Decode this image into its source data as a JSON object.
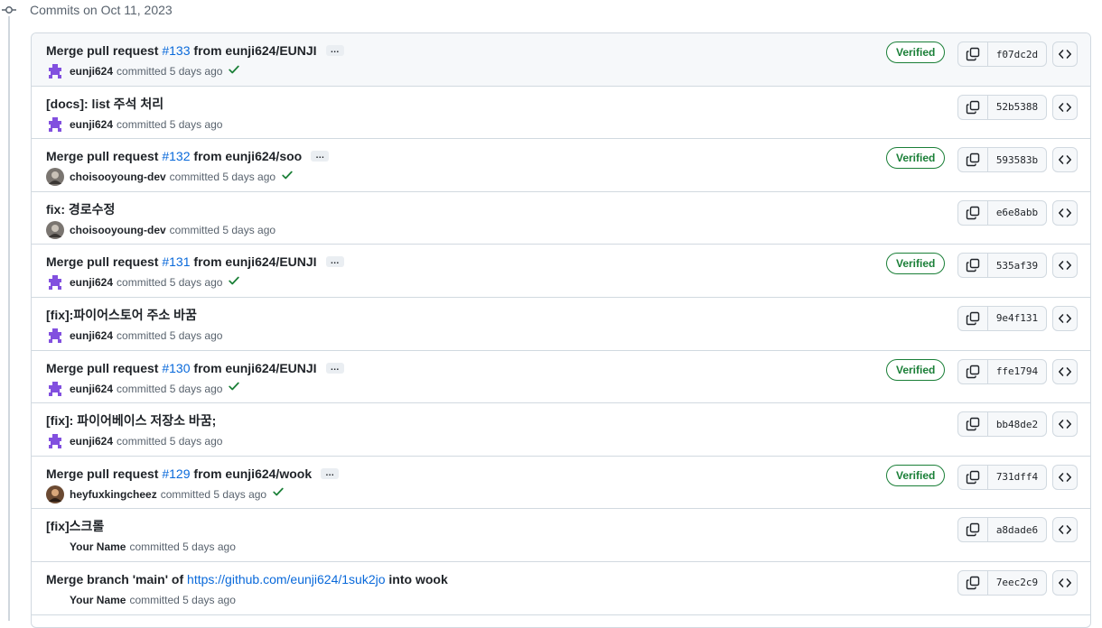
{
  "group_heading": "Commits on Oct 11, 2023",
  "verified_label": "Verified",
  "commits": [
    {
      "title_prefix": "Merge pull request ",
      "pr": "#133",
      "title_suffix": " from eunji624/EUNJI",
      "author": "eunji624",
      "meta": "committed 5 days ago",
      "verified": true,
      "check": true,
      "ellipsis": true,
      "sha": "f07dc2d",
      "avatar": "identicon"
    },
    {
      "title_prefix": "[docs]: list 주석 처리",
      "pr": "",
      "title_suffix": "",
      "author": "eunji624",
      "meta": "committed 5 days ago",
      "verified": false,
      "check": false,
      "ellipsis": false,
      "sha": "52b5388",
      "avatar": "identicon"
    },
    {
      "title_prefix": "Merge pull request ",
      "pr": "#132",
      "title_suffix": " from eunji624/soo",
      "author": "choisooyoung-dev",
      "meta": "committed 5 days ago",
      "verified": true,
      "check": true,
      "ellipsis": true,
      "sha": "593583b",
      "avatar": "photo-gray"
    },
    {
      "title_prefix": "fix: 경로수정",
      "pr": "",
      "title_suffix": "",
      "author": "choisooyoung-dev",
      "meta": "committed 5 days ago",
      "verified": false,
      "check": false,
      "ellipsis": false,
      "sha": "e6e8abb",
      "avatar": "photo-gray"
    },
    {
      "title_prefix": "Merge pull request ",
      "pr": "#131",
      "title_suffix": " from eunji624/EUNJI",
      "author": "eunji624",
      "meta": "committed 5 days ago",
      "verified": true,
      "check": true,
      "ellipsis": true,
      "sha": "535af39",
      "avatar": "identicon"
    },
    {
      "title_prefix": "[fix]:파이어스토어 주소 바꿈",
      "pr": "",
      "title_suffix": "",
      "author": "eunji624",
      "meta": "committed 5 days ago",
      "verified": false,
      "check": false,
      "ellipsis": false,
      "sha": "9e4f131",
      "avatar": "identicon"
    },
    {
      "title_prefix": "Merge pull request ",
      "pr": "#130",
      "title_suffix": " from eunji624/EUNJI",
      "author": "eunji624",
      "meta": "committed 5 days ago",
      "verified": true,
      "check": true,
      "ellipsis": true,
      "sha": "ffe1794",
      "avatar": "identicon"
    },
    {
      "title_prefix": "[fix]: 파이어베이스 저장소 바꿈;",
      "pr": "",
      "title_suffix": "",
      "author": "eunji624",
      "meta": "committed 5 days ago",
      "verified": false,
      "check": false,
      "ellipsis": false,
      "sha": "bb48de2",
      "avatar": "identicon"
    },
    {
      "title_prefix": "Merge pull request ",
      "pr": "#129",
      "title_suffix": " from eunji624/wook",
      "author": "heyfuxkingcheez",
      "meta": "committed 5 days ago",
      "verified": true,
      "check": true,
      "ellipsis": true,
      "sha": "731dff4",
      "avatar": "photo-brown"
    },
    {
      "title_prefix": "[fix]스크롤",
      "pr": "",
      "title_suffix": "",
      "author": "Your Name",
      "meta": "committed 5 days ago",
      "verified": false,
      "check": false,
      "ellipsis": false,
      "sha": "a8dade6",
      "avatar": "none"
    },
    {
      "title_prefix": "Merge branch 'main' of ",
      "pr": "https://github.com/eunji624/1suk2jo",
      "title_suffix": " into wook",
      "author": "Your Name",
      "meta": "committed 5 days ago",
      "verified": false,
      "check": false,
      "ellipsis": false,
      "sha": "7eec2c9",
      "avatar": "none"
    }
  ],
  "colors": {
    "accent": "#0969da",
    "verified": "#1a7f37",
    "identicon": "#8250df"
  }
}
